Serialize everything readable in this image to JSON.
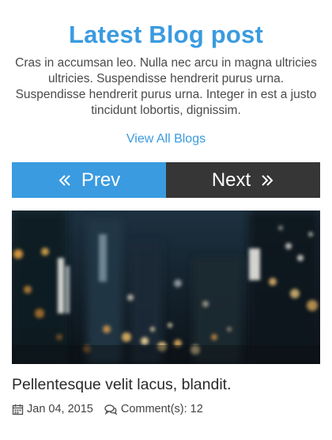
{
  "section": {
    "title": "Latest Blog post",
    "intro": "Cras in accumsan leo. Nulla nec arcu in magna ultricies ultricies. Suspendisse hendrerit purus urna. Suspendisse hendrerit purus urna. Integer in est a justo tincidunt lobortis, dignissim.",
    "view_all_label": "View All Blogs"
  },
  "pager": {
    "prev_label": "Prev",
    "next_label": "Next",
    "prev_icon": "double-chevron-left-icon",
    "next_icon": "double-chevron-right-icon"
  },
  "post": {
    "image_description_icon": "city-night-photo",
    "title": "Pellentesque velit lacus, blandit.",
    "date": "Jan 04, 2015",
    "date_icon": "calendar-icon",
    "comments": "Comment(s): 12",
    "comments_icon": "comments-icon"
  },
  "colors": {
    "accent": "#3a9be0",
    "dark": "#363636"
  }
}
